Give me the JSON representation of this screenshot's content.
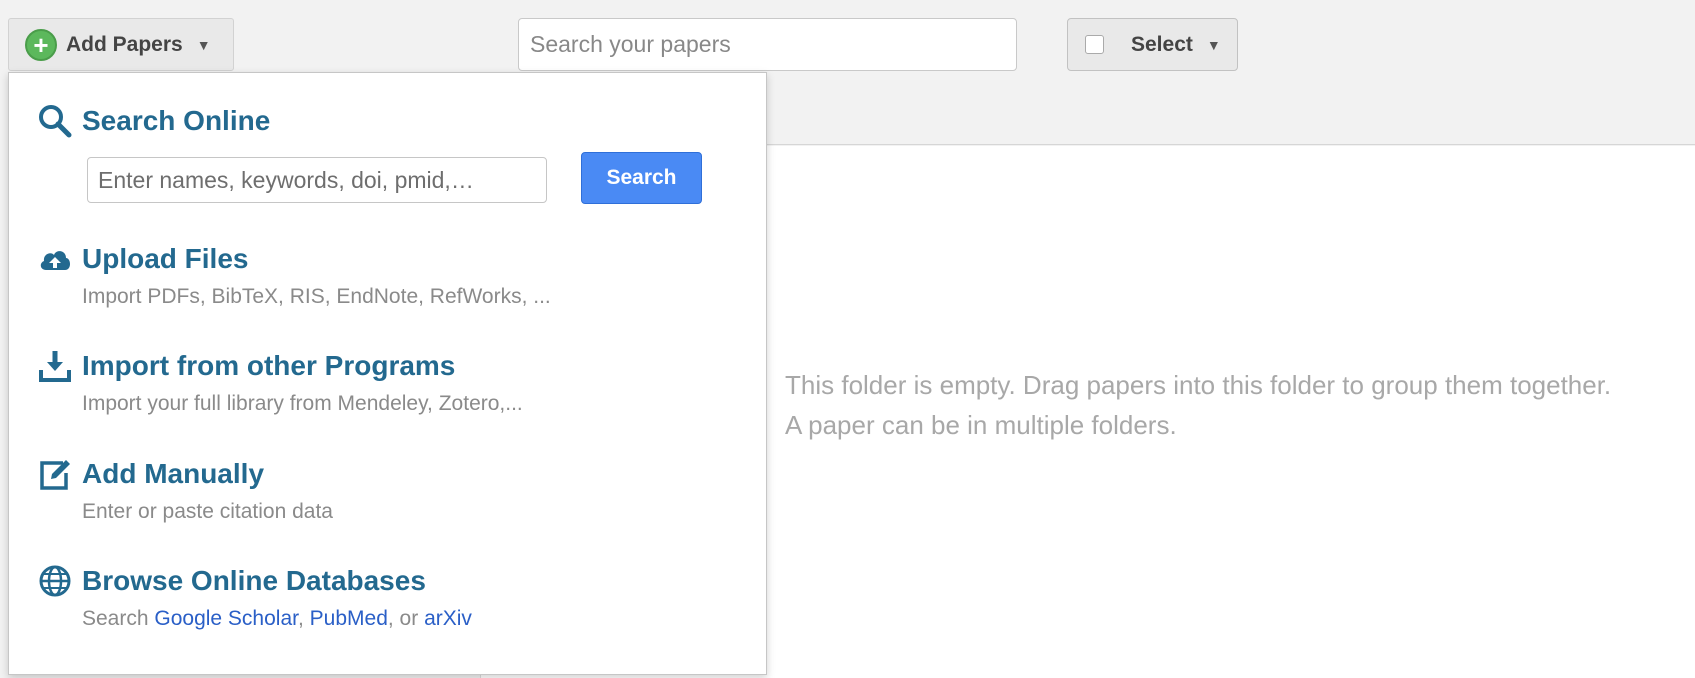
{
  "toolbar": {
    "add_papers_label": "Add Papers",
    "add_papers_caret": "▼",
    "search_placeholder": "Search your papers",
    "select_label": "Select",
    "select_caret": "▼"
  },
  "dropdown": {
    "search_online": {
      "title": "Search Online",
      "input_placeholder": "Enter names, keywords, doi, pmid,…",
      "button_label": "Search"
    },
    "upload_files": {
      "title": "Upload Files",
      "description": "Import PDFs, BibTeX, RIS, EndNote, RefWorks, ..."
    },
    "import_programs": {
      "title": "Import from other Programs",
      "description": "Import your full library from Mendeley, Zotero,..."
    },
    "add_manually": {
      "title": "Add Manually",
      "description": "Enter or paste citation data"
    },
    "browse_databases": {
      "title": "Browse Online Databases",
      "desc_prefix": "Search ",
      "link_google": "Google Scholar",
      "sep1": ", ",
      "link_pubmed": "PubMed",
      "sep2": ", or ",
      "link_arxiv": "arXiv"
    }
  },
  "main": {
    "empty_line1": "This folder is empty. Drag papers into this folder to group them together.",
    "empty_line2": "A paper can be in multiple folders."
  },
  "colors": {
    "accent_blue": "#23698f",
    "button_blue": "#4a8af4",
    "link_blue": "#2a5fc7",
    "add_green": "#5cb85c"
  },
  "icons": [
    "plus-circle-icon",
    "caret-down-icon",
    "checkbox-icon",
    "search-icon",
    "cloud-upload-icon",
    "download-icon",
    "edit-icon",
    "globe-icon"
  ]
}
